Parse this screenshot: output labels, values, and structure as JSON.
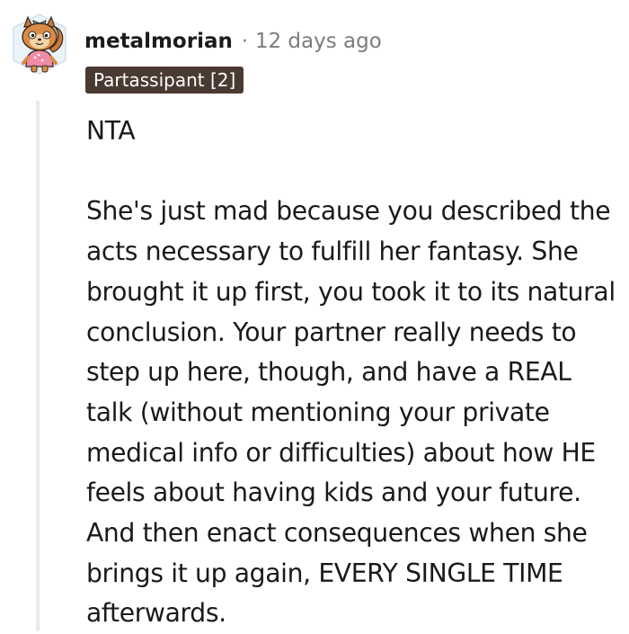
{
  "comment": {
    "avatar_icon": "squirrel-snoo-avatar-icon",
    "username": "metalmorian",
    "separator": "·",
    "timestamp": "12 days ago",
    "flair": "Partassipant [2]",
    "paragraphs": [
      "NTA",
      "She's just mad because you described the acts necessary to fulfill her fantasy. She brought it up first, you took it to its natural conclusion. Your partner really needs to step up here, though, and have a REAL talk (without mentioning your private medical info or difficulties) about how HE feels about having kids and your future. And then enact consequences when she brings it up again, EVERY SINGLE TIME afterwards."
    ]
  },
  "colors": {
    "flair_background": "#4a3b32",
    "flair_text": "#ffffff",
    "meta_gray": "#7c7c7c",
    "thread_line": "#e9e9e9"
  }
}
